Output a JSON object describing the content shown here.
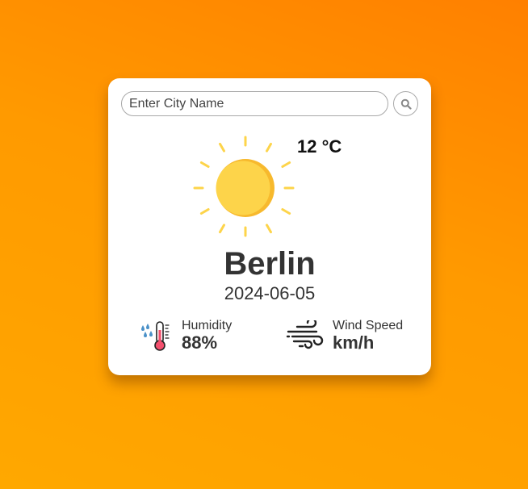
{
  "search": {
    "placeholder": "Enter City Name",
    "value": "",
    "button_icon": "search-icon"
  },
  "weather": {
    "icon": "sun-icon",
    "temperature": "12 °C",
    "city": "Berlin",
    "date": "2024-06-05"
  },
  "details": {
    "humidity": {
      "icon": "humidity-thermometer-icon",
      "label": "Humidity",
      "value": "88%"
    },
    "wind": {
      "icon": "wind-icon",
      "label": "Wind Speed",
      "value": "km/h"
    }
  },
  "colors": {
    "background_start": "#ff8000",
    "background_end": "#ffa800",
    "card": "#ffffff",
    "sun": "#fdd44a",
    "sun_shade": "#f7b92d",
    "text": "#333333"
  }
}
